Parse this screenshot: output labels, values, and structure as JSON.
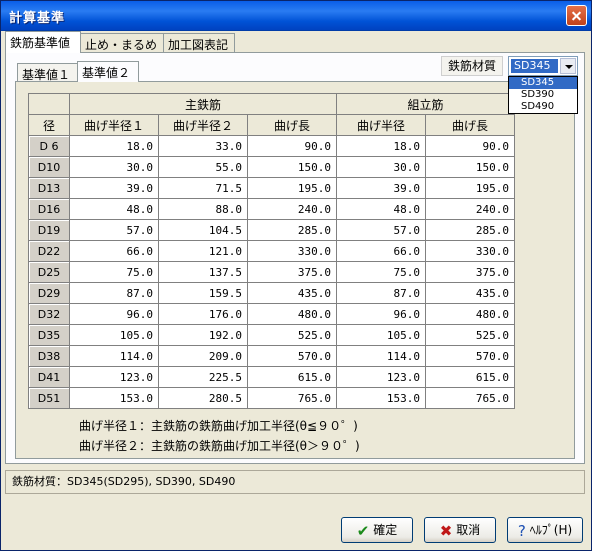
{
  "window": {
    "title": "計算基準"
  },
  "tabs": [
    "鉄筋基準値",
    "止め・まるめ",
    "加工図表記"
  ],
  "subtabs": [
    "基準値１",
    "基準値２"
  ],
  "material": {
    "label": "鉄筋材質",
    "selected": "SD345",
    "options": [
      "SD345",
      "SD390",
      "SD490"
    ]
  },
  "table": {
    "group_headers": {
      "main": "主鉄筋",
      "assembly": "組立筋"
    },
    "columns": [
      "径",
      "曲げ半径１",
      "曲げ半径２",
      "曲げ長",
      "曲げ半径",
      "曲げ長"
    ],
    "rows": [
      [
        "D 6",
        "18.0",
        "33.0",
        "90.0",
        "18.0",
        "90.0"
      ],
      [
        "D10",
        "30.0",
        "55.0",
        "150.0",
        "30.0",
        "150.0"
      ],
      [
        "D13",
        "39.0",
        "71.5",
        "195.0",
        "39.0",
        "195.0"
      ],
      [
        "D16",
        "48.0",
        "88.0",
        "240.0",
        "48.0",
        "240.0"
      ],
      [
        "D19",
        "57.0",
        "104.5",
        "285.0",
        "57.0",
        "285.0"
      ],
      [
        "D22",
        "66.0",
        "121.0",
        "330.0",
        "66.0",
        "330.0"
      ],
      [
        "D25",
        "75.0",
        "137.5",
        "375.0",
        "75.0",
        "375.0"
      ],
      [
        "D29",
        "87.0",
        "159.5",
        "435.0",
        "87.0",
        "435.0"
      ],
      [
        "D32",
        "96.0",
        "176.0",
        "480.0",
        "96.0",
        "480.0"
      ],
      [
        "D35",
        "105.0",
        "192.0",
        "525.0",
        "105.0",
        "525.0"
      ],
      [
        "D38",
        "114.0",
        "209.0",
        "570.0",
        "114.0",
        "570.0"
      ],
      [
        "D41",
        "123.0",
        "225.5",
        "615.0",
        "123.0",
        "615.0"
      ],
      [
        "D51",
        "153.0",
        "280.5",
        "765.0",
        "153.0",
        "765.0"
      ]
    ]
  },
  "notes": [
    "曲げ半径１：主鉄筋の鉄筋曲げ加工半径(θ≦９０゜)",
    "曲げ半径２：主鉄筋の鉄筋曲げ加工半径(θ＞９０゜)"
  ],
  "status": "鉄筋材質：SD345(SD295), SD390, SD490",
  "buttons": {
    "ok": "確定",
    "cancel": "取消",
    "help": "ﾍﾙﾌﾟ(H)"
  }
}
